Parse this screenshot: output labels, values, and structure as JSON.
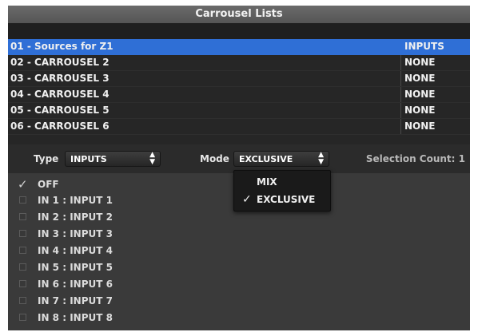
{
  "window": {
    "title": "Carrousel Lists",
    "close_glyph": "(x)"
  },
  "lists": [
    {
      "name": "01 - Sources for Z1",
      "type": "INPUTS",
      "selected": true
    },
    {
      "name": "02 - CARROUSEL 2",
      "type": "NONE",
      "selected": false
    },
    {
      "name": "03 - CARROUSEL 3",
      "type": "NONE",
      "selected": false
    },
    {
      "name": "04 - CARROUSEL 4",
      "type": "NONE",
      "selected": false
    },
    {
      "name": "05 - CARROUSEL 5",
      "type": "NONE",
      "selected": false
    },
    {
      "name": "06 - CARROUSEL 6",
      "type": "NONE",
      "selected": false
    }
  ],
  "controls": {
    "type_label": "Type",
    "type_value": "INPUTS",
    "mode_label": "Mode",
    "mode_value": "EXCLUSIVE",
    "selection_count": "Selection Count: 1"
  },
  "mode_dropdown": {
    "options": [
      {
        "label": "MIX",
        "checked": false
      },
      {
        "label": "EXCLUSIVE",
        "checked": true
      }
    ]
  },
  "items": [
    {
      "label": "OFF",
      "checked": true
    },
    {
      "label": "IN 1 : INPUT 1",
      "checked": false
    },
    {
      "label": "IN 2 : INPUT 2",
      "checked": false
    },
    {
      "label": "IN 3 : INPUT 3",
      "checked": false
    },
    {
      "label": "IN 4 : INPUT 4",
      "checked": false
    },
    {
      "label": "IN 5 : INPUT 5",
      "checked": false
    },
    {
      "label": "IN 6 : INPUT 6",
      "checked": false
    },
    {
      "label": "IN 7 : INPUT 7",
      "checked": false
    },
    {
      "label": "IN 8 : INPUT 8",
      "checked": false
    }
  ],
  "colors": {
    "selection": "#2f6fd6",
    "panel": "#3a3a3a",
    "list_bg": "#262626"
  }
}
